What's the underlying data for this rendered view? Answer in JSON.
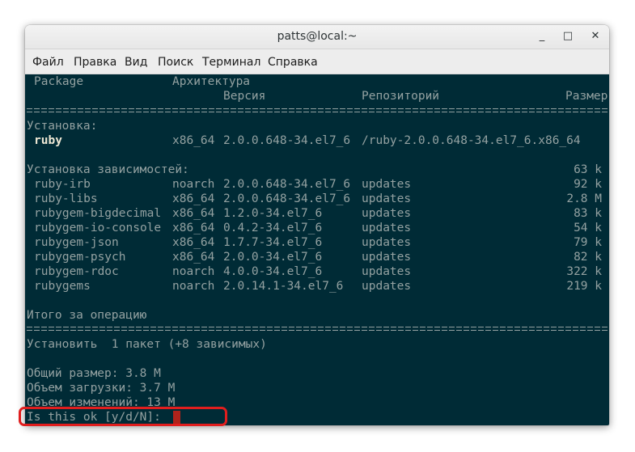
{
  "window": {
    "title": "patts@local:~",
    "controls": [
      "_",
      "□",
      "✕"
    ]
  },
  "menu": [
    "Файл",
    "Правка",
    "Вид",
    "Поиск",
    "Терминал",
    "Справка"
  ],
  "terminal": {
    "header": {
      "package": "Package",
      "arch": "Архитектура",
      "version": "Версия",
      "repo": "Репозиторий",
      "size": "Размер"
    },
    "install_label": "Установка:",
    "main_package": {
      "name": "ruby",
      "arch": "x86_64",
      "version": "2.0.0.648-34.el7_6",
      "repo": "/ruby-2.0.0.648-34.el7_6.x86_64",
      "size": "63 k"
    },
    "deps_label": "Установка зависимостей:",
    "deps": [
      {
        "name": "ruby-irb",
        "arch": "noarch",
        "version": "2.0.0.648-34.el7_6",
        "repo": "updates",
        "size": "92 k"
      },
      {
        "name": "ruby-libs",
        "arch": "x86_64",
        "version": "2.0.0.648-34.el7_6",
        "repo": "updates",
        "size": "2.8 M"
      },
      {
        "name": "rubygem-bigdecimal",
        "arch": "x86_64",
        "version": "1.2.0-34.el7_6",
        "repo": "updates",
        "size": "83 k"
      },
      {
        "name": "rubygem-io-console",
        "arch": "x86_64",
        "version": "0.4.2-34.el7_6",
        "repo": "updates",
        "size": "54 k"
      },
      {
        "name": "rubygem-json",
        "arch": "x86_64",
        "version": "1.7.7-34.el7_6",
        "repo": "updates",
        "size": "79 k"
      },
      {
        "name": "rubygem-psych",
        "arch": "x86_64",
        "version": "2.0.0-34.el7_6",
        "repo": "updates",
        "size": "82 k"
      },
      {
        "name": "rubygem-rdoc",
        "arch": "noarch",
        "version": "4.0.0-34.el7_6",
        "repo": "updates",
        "size": "322 k"
      },
      {
        "name": "rubygems",
        "arch": "noarch",
        "version": "2.0.14.1-34.el7_6",
        "repo": "updates",
        "size": "219 k"
      }
    ],
    "summary_label": "Итого за операцию",
    "install_summary": "Установить  1 пакет (+8 зависимых)",
    "total_size": "Общий размер: 3.8 M",
    "download_size": "Объем загрузки: 3.7 M",
    "change_size": "Объем изменений: 13 M",
    "prompt": "Is this ok [y/d/N]: "
  }
}
